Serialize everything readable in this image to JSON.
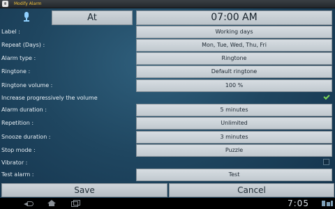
{
  "window": {
    "title": "Modify Alarm"
  },
  "header": {
    "mode_label": "At",
    "time": "07:00 AM"
  },
  "settings": [
    {
      "label": "Label :",
      "value": "Working days"
    },
    {
      "label": "Repeat (Days) :",
      "value": "Mon, Tue, Wed, Thu, Fri"
    },
    {
      "label": "Alarm type :",
      "value": "Ringtone"
    },
    {
      "label": "Ringtone :",
      "value": "Default ringtone"
    },
    {
      "label": "Ringtone volume :",
      "value": "100 %"
    },
    {
      "label": "Increase progressively the volume",
      "checked": true
    },
    {
      "label": "Alarm duration :",
      "value": "5 minutes"
    },
    {
      "label": "Repetition :",
      "value": "Unlimited"
    },
    {
      "label": "Snooze duration :",
      "value": "3 minutes"
    },
    {
      "label": "Stop mode :",
      "value": "Puzzle"
    },
    {
      "label": "Vibrator :",
      "checked": false
    },
    {
      "label": "Test alarm :",
      "value": "Test"
    }
  ],
  "actions": {
    "save_label": "Save",
    "cancel_label": "Cancel"
  },
  "statusbar": {
    "clock": "7:05"
  },
  "colors": {
    "title_accent": "#f2c23a",
    "check_color": "#7ed957"
  }
}
